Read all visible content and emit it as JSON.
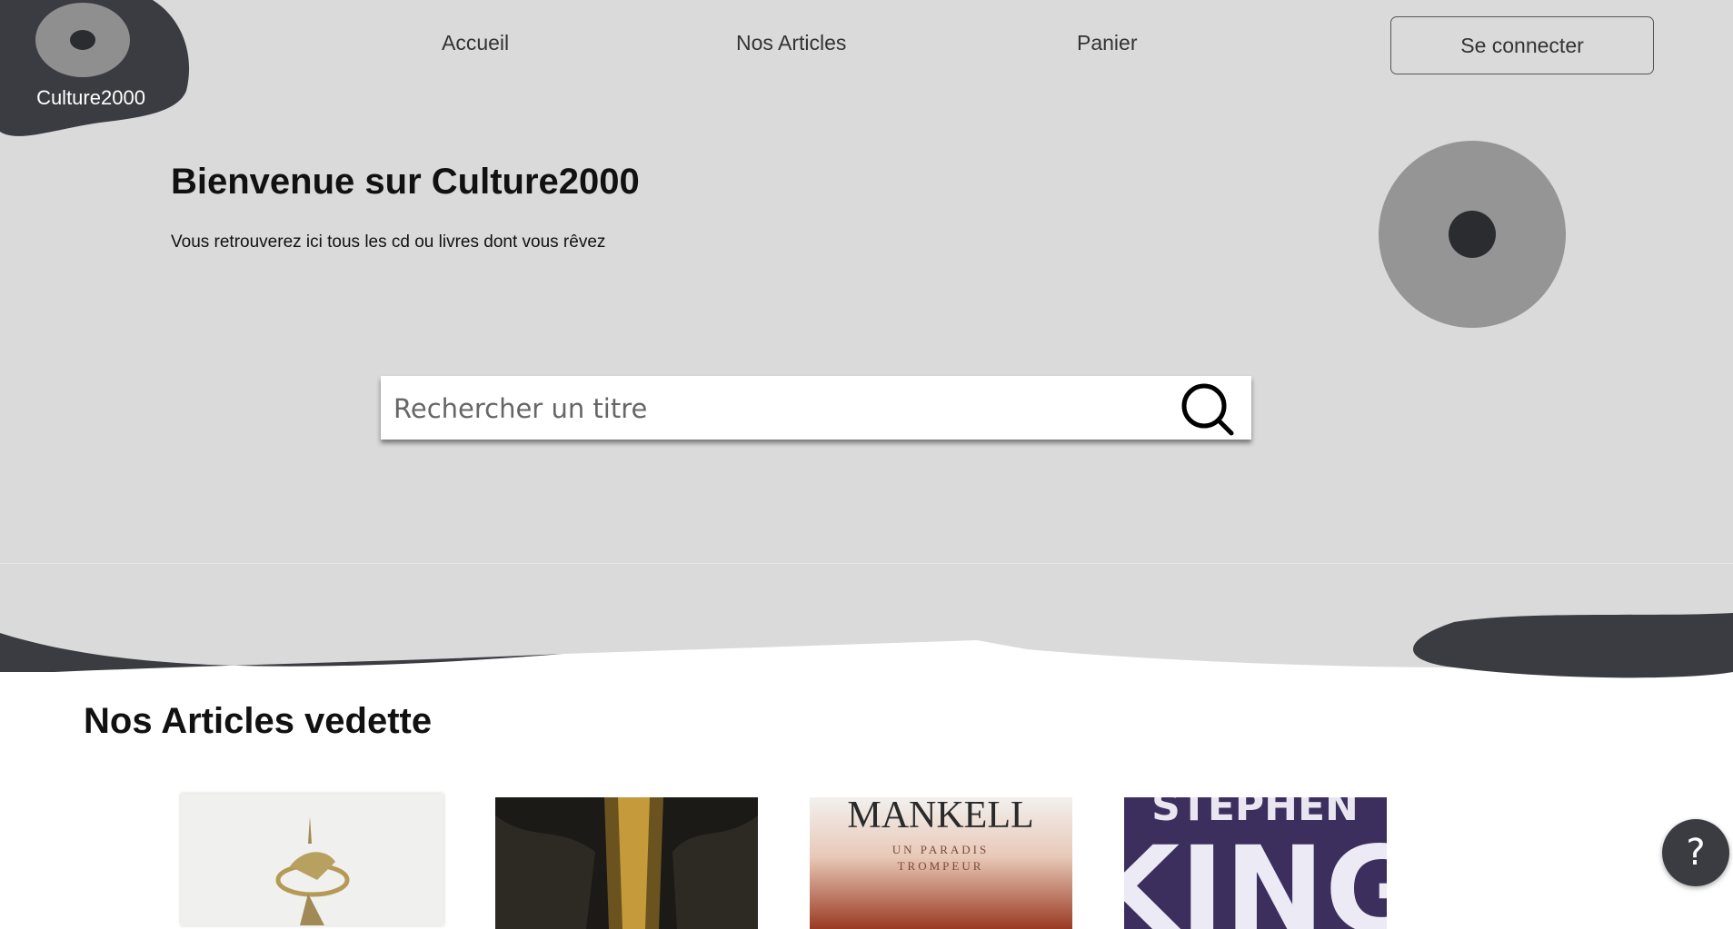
{
  "brand": {
    "name": "Culture2000"
  },
  "nav": {
    "home": "Accueil",
    "articles": "Nos Articles",
    "cart": "Panier",
    "login": "Se connecter"
  },
  "hero": {
    "title": "Bienvenue sur Culture2000",
    "subtitle": "Vous retrouverez ici tous les cd ou livres dont vous rêvez"
  },
  "search": {
    "placeholder": "Rechercher un titre",
    "value": ""
  },
  "featured": {
    "title": "Nos Articles vedette",
    "items": [
      {
        "cover_text": ""
      },
      {
        "cover_text": ""
      },
      {
        "cover_text": "MANKELL",
        "cover_subtitle": "UN PARADIS TROMPEUR"
      },
      {
        "cover_text": "STEPHEN KING"
      }
    ]
  },
  "help": {
    "label": "?"
  },
  "colors": {
    "hero_bg": "#dadada",
    "dark": "#3a3c41",
    "disc_outer": "#8f8f8f",
    "disc_inner": "#2a2c30"
  },
  "icons": [
    "logo-disc-icon",
    "disc-icon",
    "search-icon",
    "help-icon"
  ]
}
